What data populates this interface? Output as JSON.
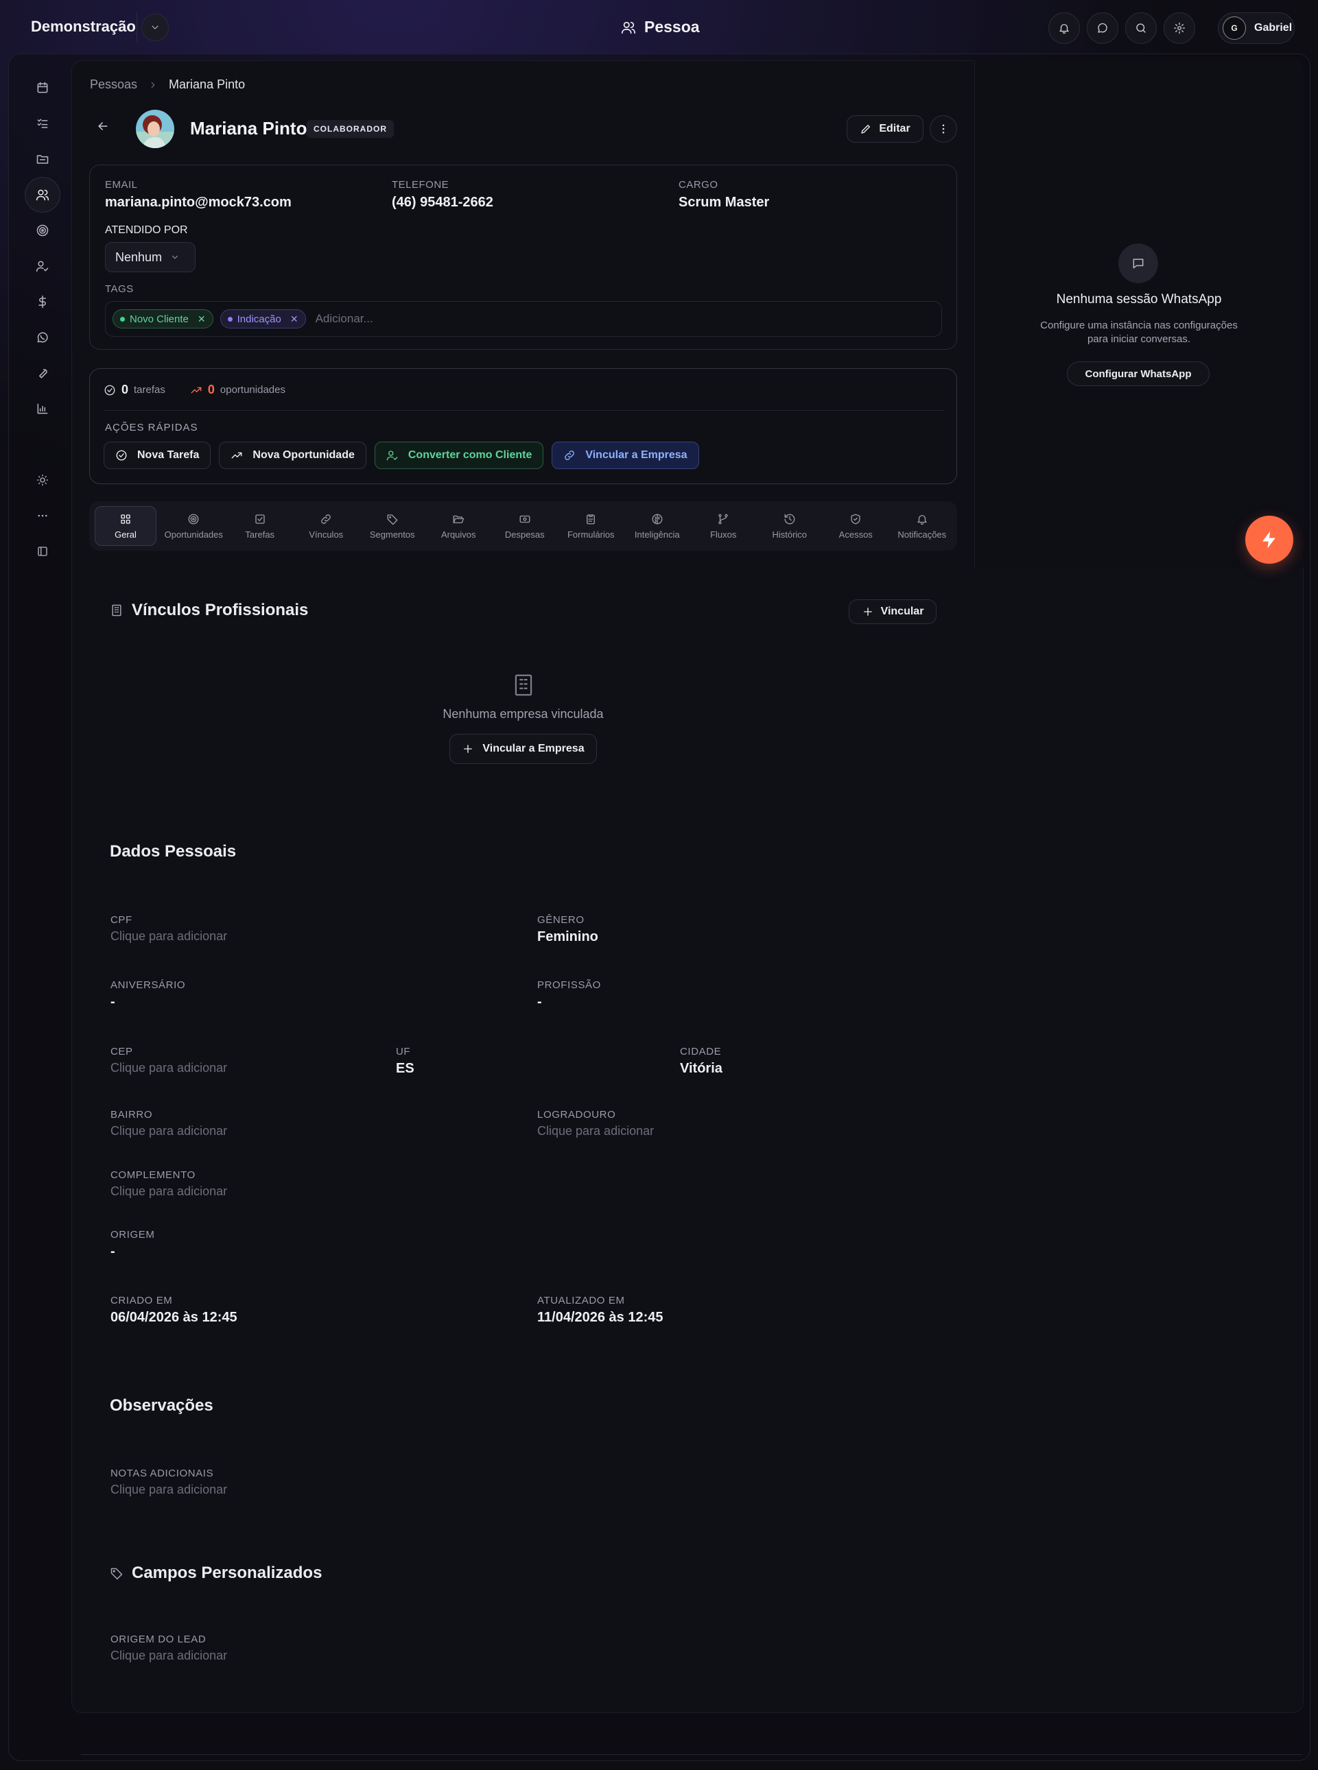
{
  "topbar": {
    "org_name": "Demonstração",
    "page_title": "Pessoa",
    "user_initial": "G",
    "user_name": "Gabriel"
  },
  "breadcrumb": {
    "parent": "Pessoas",
    "current": "Mariana Pinto"
  },
  "person": {
    "name": "Mariana Pinto",
    "role_badge": "COLABORADOR",
    "edit_label": "Editar"
  },
  "info": {
    "email_label": "EMAIL",
    "email": "mariana.pinto@mock73.com",
    "phone_label": "TELEFONE",
    "phone": "(46) 95481-2662",
    "position_label": "CARGO",
    "position": "Scrum Master",
    "attended_label": "ATENDIDO POR",
    "attended_value": "Nenhum",
    "tags_label": "TAGS",
    "tags": [
      {
        "label": "Novo Cliente",
        "color": "#3dd68c"
      },
      {
        "label": "Indicação",
        "color": "#8b7dff"
      }
    ],
    "tags_placeholder": "Adicionar..."
  },
  "stats": {
    "tasks_count": "0",
    "tasks_label": "tarefas",
    "opps_count": "0",
    "opps_label": "oportunidades"
  },
  "quick_actions": {
    "title": "AÇÕES RÁPIDAS",
    "new_task": "Nova Tarefa",
    "new_opportunity": "Nova Oportunidade",
    "convert_client": "Converter como Cliente",
    "link_company": "Vincular a Empresa"
  },
  "tabs": [
    "Geral",
    "Oportunidades",
    "Tarefas",
    "Vínculos",
    "Segmentos",
    "Arquivos",
    "Despesas",
    "Formulários",
    "Inteligência",
    "Fluxos",
    "Histórico",
    "Acessos",
    "Notificações"
  ],
  "whatsapp": {
    "title": "Nenhuma sessão WhatsApp",
    "desc": "Configure uma instância nas configurações para iniciar conversas.",
    "button": "Configurar WhatsApp"
  },
  "vinculos": {
    "title": "Vínculos Profissionais",
    "add_label": "Vincular",
    "empty_text": "Nenhuma empresa vinculada",
    "empty_button": "Vincular a Empresa"
  },
  "personal": {
    "title": "Dados Pessoais",
    "cpf_label": "CPF",
    "cpf_value": "Clique para adicionar",
    "gender_label": "GÊNERO",
    "gender_value": "Feminino",
    "birthday_label": "ANIVERSÁRIO",
    "birthday_value": "-",
    "profession_label": "PROFISSÃO",
    "profession_value": "-",
    "cep_label": "CEP",
    "cep_value": "Clique para adicionar",
    "uf_label": "UF",
    "uf_value": "ES",
    "city_label": "CIDADE",
    "city_value": "Vitória",
    "district_label": "BAIRRO",
    "district_value": "Clique para adicionar",
    "street_label": "LOGRADOURO",
    "street_value": "Clique para adicionar",
    "complement_label": "COMPLEMENTO",
    "complement_value": "Clique para adicionar",
    "origin_label": "ORIGEM",
    "origin_value": "-",
    "created_label": "CRIADO EM",
    "created_value": "06/04/2026 às 12:45",
    "updated_label": "ATUALIZADO EM",
    "updated_value": "11/04/2026 às 12:45"
  },
  "notes": {
    "title": "Observações",
    "label": "NOTAS ADICIONAIS",
    "value": "Clique para adicionar"
  },
  "custom": {
    "title": "Campos Personalizados",
    "lead_origin_label": "ORIGEM DO LEAD",
    "lead_origin_value": "Clique para adicionar"
  },
  "colors": {
    "accent": "#ff6a43",
    "success": "#3dd68c",
    "link": "#8fb1ff"
  }
}
